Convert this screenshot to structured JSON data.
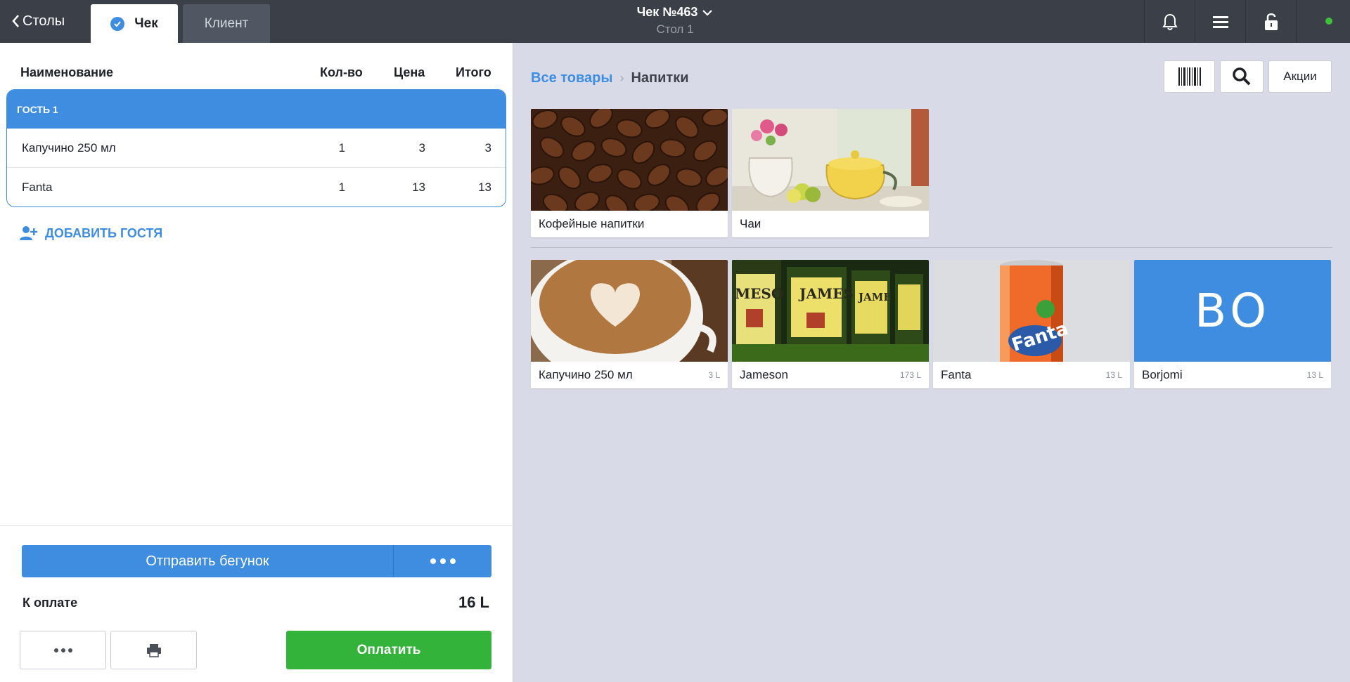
{
  "topbar": {
    "back_label": "Столы",
    "tabs": [
      {
        "label": "Чек",
        "active": true
      },
      {
        "label": "Клиент",
        "active": false
      }
    ],
    "receipt_title": "Чек №463",
    "table_label": "Стол 1",
    "icons": [
      "bell-icon",
      "menu-icon",
      "lock-icon"
    ],
    "status_color": "#3cc23a"
  },
  "order": {
    "columns": {
      "name": "Наименование",
      "qty": "Кол-во",
      "price": "Цена",
      "total": "Итого"
    },
    "guest_label": "Гость 1",
    "items": [
      {
        "name": "Капучино 250 мл",
        "qty": "1",
        "price": "3",
        "total": "3"
      },
      {
        "name": "Fanta",
        "qty": "1",
        "price": "13",
        "total": "13"
      }
    ],
    "add_guest_label": "ДОБАВИТЬ ГОСТЯ",
    "send_label": "Отправить бегунок",
    "pay_label": "К оплате",
    "pay_amount": "16 L",
    "pay_button": "Оплатить"
  },
  "catalog": {
    "breadcrumb": {
      "root": "Все товары",
      "separator": "›",
      "current": "Напитки"
    },
    "tools": {
      "promo_label": "Акции"
    },
    "categories": [
      {
        "name": "Кофейные напитки"
      },
      {
        "name": "Чаи"
      }
    ],
    "products": [
      {
        "name": "Капучино 250 мл",
        "price": "3 L"
      },
      {
        "name": "Jameson",
        "price": "173 L"
      },
      {
        "name": "Fanta",
        "price": "13 L"
      },
      {
        "name": "Borjomi",
        "price": "13 L",
        "initials": "BO"
      }
    ]
  },
  "colors": {
    "accent": "#3e8de0",
    "pay": "#34b33a",
    "topbar": "#3a3f48"
  }
}
